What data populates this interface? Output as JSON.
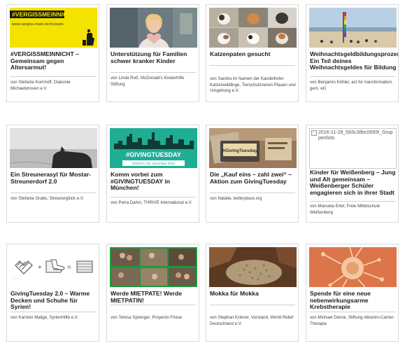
{
  "cards": [
    {
      "title": "#VERGISSMEINNICHT – Gemeinsam gegen Altersarmut!",
      "author": "von Stefanie Kornhoff, Diakonie Michaelshoven e.V.",
      "banner_headline": "#VERGISSMEINNICHT",
      "banner_url": "www.vergiss-mein-nicht.koeln",
      "banner_color": "#f4e200"
    },
    {
      "title": "Unterstützung für Familien schwer kranker Kinder",
      "author": "von Linda Roß, McDonald's Kinderhilfe Stiftung"
    },
    {
      "title": "Katzenpaten gesucht",
      "author": "von Sandra im Namen der Kandelhofer Katzenwildlinge, Tierschutzverein Plauen und Umgebung e.V."
    },
    {
      "title": "Weihnachtsgeldbildungsprozent: Ein Teil deines Weihnachtsgeldes für Bildung",
      "author": "von Benjamin Köhler, act for transformation, gem. eG"
    },
    {
      "title": "Ein Streunerasyl für Mostar-Streunerdorf 2.0",
      "author": "von Stefanie Grabs, Streunerglück e.V."
    },
    {
      "title": "Komm vorbei zum #GIVINGTUESDAY in München!",
      "author": "von Petra Dahm, THRIVE International e.V.",
      "banner_headline": "#GIVINGTUESDAY",
      "banner_sub": "MÜNCH | 29. November 2016",
      "banner_color": "#1fae94"
    },
    {
      "title": "Die „Kauf eins – zahl zwei“ – Aktion zum GivingTuesday",
      "author": "von Natalie, betterplace.org",
      "banner_headline": "#GivingTuesday"
    },
    {
      "title": "Kinder für Weißenberg – Jung und Alt gemeinsam – Weißenberger Schüler engagieren sich in ihrer Stadt",
      "author": "von Manuela Ertel, Freie Mittelschule Weißenberg",
      "broken_alt": "2016-11-28_583c38bc0665f_Gruppenfoto"
    },
    {
      "title": "GivingTuesday 2.0 – Warme Decken und Schuhe für Syrien!",
      "author": "von Karsten Malige, SyrienHilfe e.V."
    },
    {
      "title": "Werde MIETPATE! Werde MIETPATIN!",
      "author": "von Teresa Sprenger, Proyecto Friese"
    },
    {
      "title": "Mokka für Mokka",
      "author": "von Stephan Krämer, Vorstand, World Relief Deutschland e.V."
    },
    {
      "title": "Spende für eine neue nebenwirkungsarme Krebstherapie",
      "author": "von Michael Denck, Stiftung Albumin-Carrier-Therapie"
    }
  ]
}
